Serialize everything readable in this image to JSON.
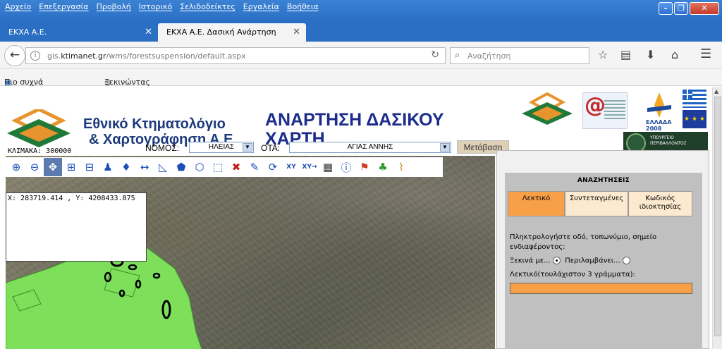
{
  "browser": {
    "menu": [
      "Αρχείο",
      "Επεξεργασία",
      "Προβολή",
      "Ιστορικό",
      "Σελιδοδείκτες",
      "Εργαλεία",
      "Βοήθεια"
    ],
    "tabs": [
      {
        "label": "ΕΚΧΑ Α.Ε."
      },
      {
        "label": "ΕΚΧΑ Α.Ε. Δασική Ανάρτηση"
      }
    ],
    "url_host": "gis.ktimanet.gr",
    "url_prefix": "gis.",
    "url_domain": "ktimanet.gr",
    "url_path": "/wms/forestsuspension/default.aspx",
    "search_placeholder": "Αναζήτηση",
    "bookmarks": [
      "Πιο συχνά αναγνωσμ...",
      "Ξεκινώντας"
    ]
  },
  "header": {
    "brand_line1": "Εθνικό Κτηματολόγιο",
    "brand_line2": "& Χαρτογράφηση Α.Ε.",
    "title": "ΑΝΑΡΤΗΣΗ ΔΑΣΙΚΟΥ ΧΑΡΤΗ",
    "scale": "ΚΛΙΜΑΚΑ: 300000",
    "nomos_label": "ΝΟΜΟΣ:",
    "nomos_value": "ΗΛΕΙΑΣ",
    "ota_label": "ΟΤΑ:",
    "ota_value": "ΑΓΙΑΣ ΑΝΝΗΣ",
    "go_button": "Μετάβαση",
    "ministry_text": "ΥΠΟΥΡΓΕΙΟ ΠΕΡΙΒΑΛΛΟΝΤΟΣ",
    "logo_year": "ΕΛΛΑΔΑ 2008"
  },
  "map": {
    "coords": "X: 283719.414 , Y: 4208433.875",
    "tools": [
      "zoom-in-icon",
      "zoom-out-icon",
      "pan-icon",
      "zoom-box-in-icon",
      "zoom-box-out-icon",
      "user-locate-icon",
      "greece-map-icon",
      "measure-line-icon",
      "measure-angle-icon",
      "polygon-icon",
      "shape-icon",
      "select-icon",
      "delete-icon",
      "draw-icon",
      "refresh-icon",
      "xy-search-icon",
      "xy-goto-icon",
      "legend-icon",
      "info-icon",
      "flag-icon",
      "tree-icon",
      "broom-icon"
    ]
  },
  "search_panel": {
    "title": "ΑΝΑΖΗΤΗΣΕΙΣ",
    "tabs": [
      "Λεκτικό",
      "Συντεταγμένες",
      "Κωδικός ιδιοκτησίας"
    ],
    "instruction": "Πληκτρολογήστε οδό, τοπωνύμιο, σημείο ενδιαφέροντος:",
    "radio1": "Ξεκινά με...",
    "radio2": "Περιλαμβάνει...",
    "min_label": "Λεκτικό(τουλάχιστον 3 γράμματα):",
    "input_value": ""
  },
  "colors": {
    "accent": "#f8a048",
    "brand": "#1c3a7c",
    "forest": "#7ee05a"
  }
}
